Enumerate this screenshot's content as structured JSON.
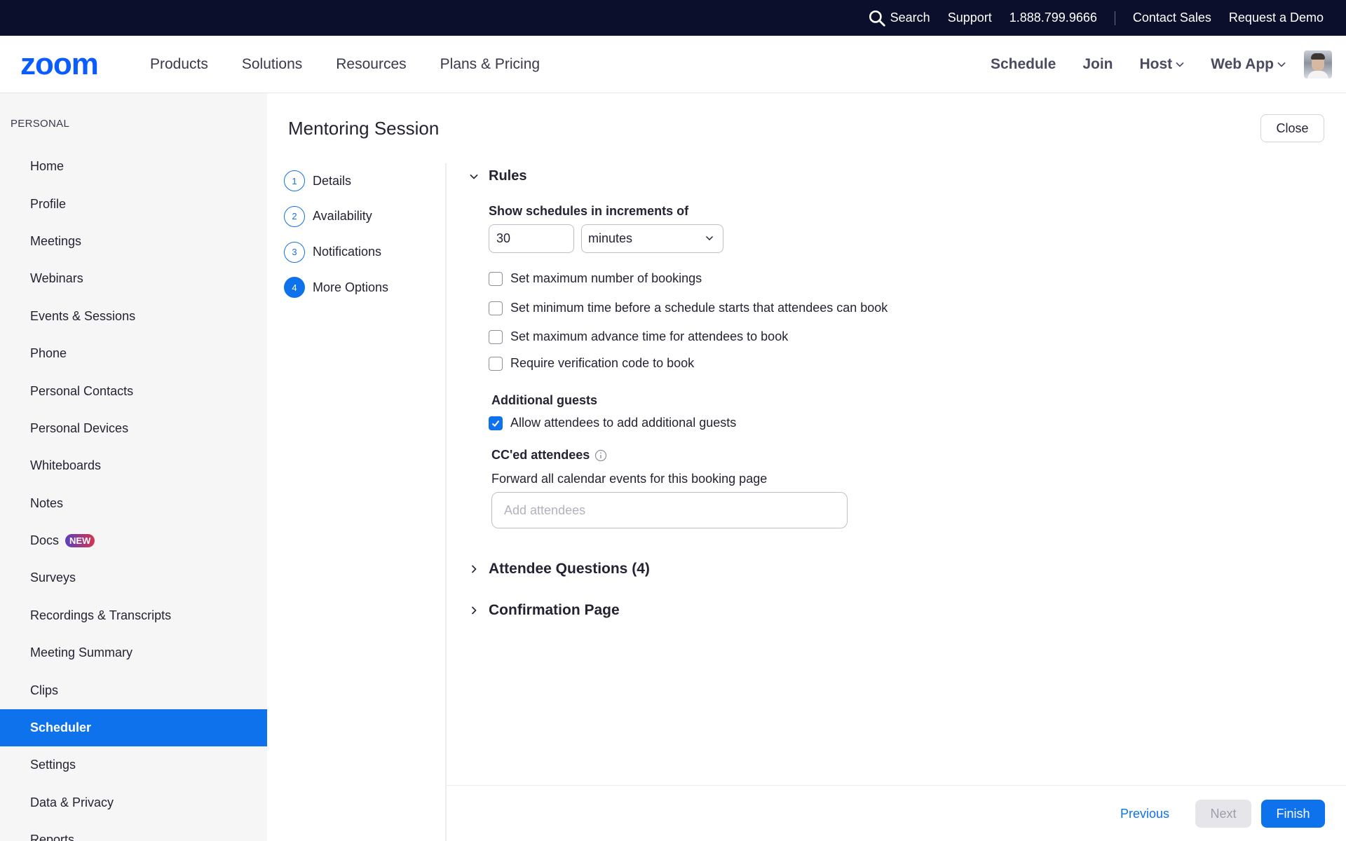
{
  "topbar": {
    "search": "Search",
    "support": "Support",
    "phone": "1.888.799.9666",
    "contact_sales": "Contact Sales",
    "request_demo": "Request a Demo"
  },
  "nav": {
    "logo": "zoom",
    "products": "Products",
    "solutions": "Solutions",
    "resources": "Resources",
    "plans": "Plans & Pricing",
    "schedule": "Schedule",
    "join": "Join",
    "host": "Host",
    "web_app": "Web App"
  },
  "sidebar": {
    "section": "PERSONAL",
    "items": [
      {
        "label": "Home"
      },
      {
        "label": "Profile"
      },
      {
        "label": "Meetings"
      },
      {
        "label": "Webinars"
      },
      {
        "label": "Events & Sessions"
      },
      {
        "label": "Phone"
      },
      {
        "label": "Personal Contacts"
      },
      {
        "label": "Personal Devices"
      },
      {
        "label": "Whiteboards"
      },
      {
        "label": "Notes"
      },
      {
        "label": "Docs",
        "badge": "NEW"
      },
      {
        "label": "Surveys"
      },
      {
        "label": "Recordings & Transcripts"
      },
      {
        "label": "Meeting Summary"
      },
      {
        "label": "Clips"
      },
      {
        "label": "Scheduler",
        "active": true
      },
      {
        "label": "Settings"
      },
      {
        "label": "Data & Privacy"
      },
      {
        "label": "Reports"
      }
    ]
  },
  "page": {
    "title": "Mentoring Session",
    "close": "Close"
  },
  "steps": [
    {
      "num": "1",
      "label": "Details"
    },
    {
      "num": "2",
      "label": "Availability"
    },
    {
      "num": "3",
      "label": "Notifications"
    },
    {
      "num": "4",
      "label": "More Options",
      "active": true
    }
  ],
  "rules": {
    "title": "Rules",
    "increments_label": "Show schedules in increments of",
    "increment_value": "30",
    "increment_unit": "minutes",
    "checkboxes": [
      {
        "label": "Set maximum number of bookings",
        "checked": false
      },
      {
        "label": "Set minimum time before a schedule starts that attendees can book",
        "checked": false
      },
      {
        "label": "Set maximum advance time for attendees to book",
        "checked": false
      },
      {
        "label": "Require verification code to book",
        "checked": false
      }
    ],
    "additional_guests_label": "Additional guests",
    "allow_guests": {
      "label": "Allow attendees to add additional guests",
      "checked": true
    },
    "cc_label": "CC'ed attendees",
    "cc_description": "Forward all calendar events for this booking page",
    "cc_placeholder": "Add attendees"
  },
  "sections": {
    "attendee_questions": "Attendee Questions (4)",
    "confirmation_page": "Confirmation Page"
  },
  "footer": {
    "previous": "Previous",
    "next": "Next",
    "finish": "Finish"
  },
  "colors": {
    "accent": "#0e72ed",
    "topbar_bg": "#0b0f2b",
    "sidebar_bg": "#f6f6f7"
  }
}
